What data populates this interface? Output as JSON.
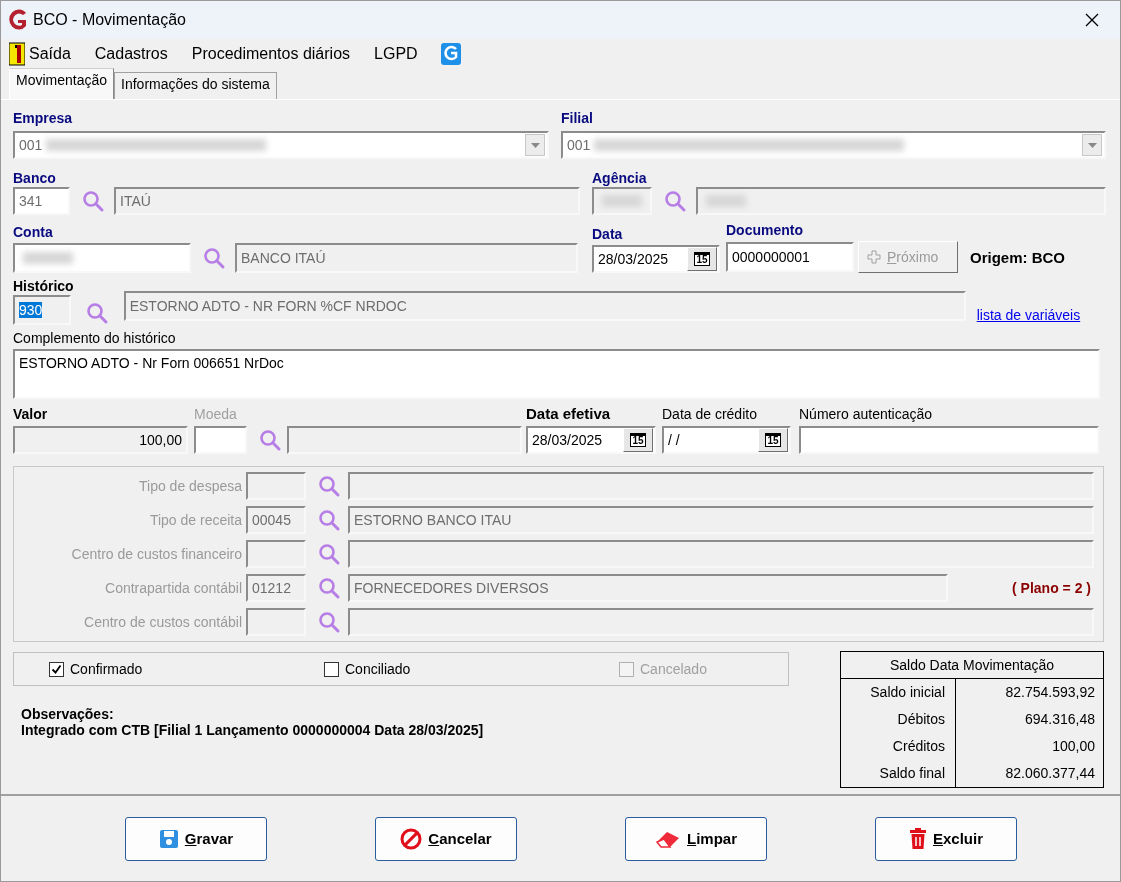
{
  "window": {
    "title": "BCO - Movimentação"
  },
  "menu": [
    {
      "label": "Saída",
      "kind": "exit"
    },
    {
      "label": "Cadastros",
      "kind": "text"
    },
    {
      "label": "Procedimentos diários",
      "kind": "text"
    },
    {
      "label": "LGPD",
      "kind": "text"
    }
  ],
  "tabs": [
    {
      "label": "Movimentação",
      "selected": true
    },
    {
      "label": "Informações do sistema",
      "selected": false
    }
  ],
  "empresa": {
    "label": "Empresa",
    "value": "001"
  },
  "filial": {
    "label": "Filial",
    "value": "001"
  },
  "banco": {
    "label": "Banco",
    "code": "341",
    "name": "ITAÚ"
  },
  "agencia": {
    "label": "Agência"
  },
  "conta": {
    "label": "Conta",
    "name": "BANCO ITAÚ"
  },
  "data": {
    "label": "Data",
    "value": "28/03/2025",
    "calendar_day": "15"
  },
  "documento": {
    "label": "Documento",
    "value": "0000000001"
  },
  "proximo_button": {
    "label": "Próximo",
    "disabled": true
  },
  "origem": "Origem: BCO",
  "historico": {
    "label": "Histórico",
    "code": "930",
    "code_selected": true,
    "description": "ESTORNO ADTO - NR FORN %CF NRDOC"
  },
  "variables_link": "lista de variáveis",
  "complemento": {
    "label": "Complemento do histórico",
    "value": "ESTORNO ADTO - Nr Forn 006651 NrDoc"
  },
  "valor": {
    "label": "Valor",
    "value": "100,00"
  },
  "moeda": {
    "label": "Moeda",
    "disabled": true
  },
  "data_efetiva": {
    "label": "Data efetiva",
    "value": "28/03/2025",
    "calendar_day": "15"
  },
  "data_credito": {
    "label": "Data de crédito",
    "value": "/ /",
    "calendar_day": "15"
  },
  "numero_autenticacao": {
    "label": "Número autenticação"
  },
  "classification": [
    {
      "label": "Tipo de despesa"
    },
    {
      "label": "Tipo de receita",
      "code": "00045",
      "description": "ESTORNO BANCO ITAU"
    },
    {
      "label": "Centro de custos financeiro"
    },
    {
      "label": "Contrapartida contábil",
      "code": "01212",
      "description": "FORNECEDORES DIVERSOS",
      "note": "( Plano = 2 )"
    },
    {
      "label": "Centro de custos contábil"
    }
  ],
  "checkboxes": [
    {
      "label": "Confirmado",
      "checked": true,
      "disabled": false
    },
    {
      "label": "Conciliado",
      "checked": false,
      "disabled": false
    },
    {
      "label": "Cancelado",
      "checked": false,
      "disabled": true
    }
  ],
  "observacoes": {
    "label": "Observações:",
    "text": "Integrado com CTB [Filial 1 Lançamento 0000000004 Data 28/03/2025]"
  },
  "saldo": {
    "title": "Saldo Data Movimentação",
    "rows": [
      {
        "label": "Saldo inicial",
        "value": "82.754.593,92"
      },
      {
        "label": "Débitos",
        "value": "694.316,48"
      },
      {
        "label": "Créditos",
        "value": "100,00"
      },
      {
        "label": "Saldo final",
        "value": "82.060.377,44"
      }
    ]
  },
  "buttons": [
    {
      "label": "Gravar",
      "kind": "save"
    },
    {
      "label": "Cancelar",
      "kind": "cancel"
    },
    {
      "label": "Limpar",
      "kind": "clear"
    },
    {
      "label": "Excluir",
      "kind": "delete"
    }
  ]
}
